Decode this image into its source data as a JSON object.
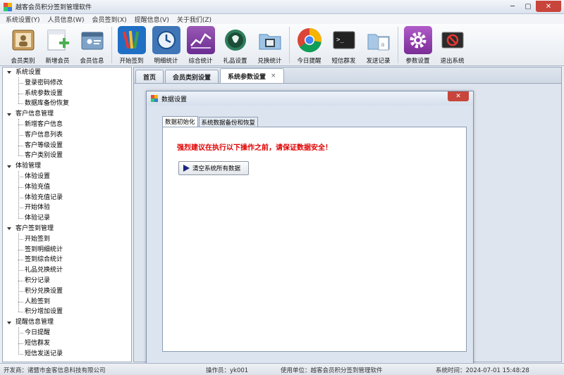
{
  "window": {
    "title": "越客会员积分签到管理软件"
  },
  "menu": [
    "系统设置(Y)",
    "人员信息(W)",
    "会员签到(X)",
    "提醒信息(V)",
    "关于我们(Z)"
  ],
  "toolbar": [
    {
      "label": "会员类别",
      "icon": "member-category-icon"
    },
    {
      "label": "新增会员",
      "icon": "add-member-icon"
    },
    {
      "label": "会员信息",
      "icon": "member-info-icon"
    },
    {
      "label": "开始签到",
      "icon": "start-signin-icon"
    },
    {
      "label": "明细统计",
      "icon": "detail-stats-icon"
    },
    {
      "label": "综合统计",
      "icon": "overall-stats-icon"
    },
    {
      "label": "礼品设置",
      "icon": "gift-settings-icon"
    },
    {
      "label": "兑换统计",
      "icon": "exchange-stats-icon"
    },
    {
      "label": "今日提醒",
      "icon": "today-reminder-icon"
    },
    {
      "label": "短信群发",
      "icon": "sms-broadcast-icon"
    },
    {
      "label": "发送记录",
      "icon": "send-record-icon"
    },
    {
      "label": "参数设置",
      "icon": "parameter-settings-icon"
    },
    {
      "label": "退出系统",
      "icon": "exit-system-icon"
    }
  ],
  "sidebar": [
    {
      "label": "系统设置",
      "children": [
        "登录密码修改",
        "系统参数设置",
        "数据库备份恢复"
      ]
    },
    {
      "label": "客户信息管理",
      "children": [
        "新增客户信息",
        "客户信息列表",
        "客户等级设置",
        "客户类别设置"
      ]
    },
    {
      "label": "体验管理",
      "children": [
        "体验设置",
        "体验充值",
        "体验充值记录",
        "开始体验",
        "体验记录"
      ]
    },
    {
      "label": "客户签到管理",
      "children": [
        "开始签到",
        "签到明细统计",
        "签到综合统计",
        "礼品兑换统计",
        "积分记录",
        "积分兑换设置",
        "人脸签到",
        "积分增加设置"
      ]
    },
    {
      "label": "提醒信息管理",
      "children": [
        "今日提醒",
        "短信群发",
        "短信发送记录"
      ]
    }
  ],
  "tabs": [
    {
      "label": "首页"
    },
    {
      "label": "会员类别设置"
    },
    {
      "label": "系统参数设置",
      "close": "×"
    }
  ],
  "dialog": {
    "title": "数据设置",
    "close": "✕",
    "tabs": [
      "数据初始化",
      "系统数据备份和恢复"
    ],
    "warning": "强烈建议在执行以下操作之前，请保证数据安全！",
    "button": "清空系统所有数据"
  },
  "status": {
    "developer": "开发商：诸暨市金客信息科技有限公司",
    "operator": "操作员：yk001",
    "unit": "使用单位：越客会员积分签到管理软件",
    "time": "系统时间：2024-07-01 15:48:28"
  },
  "colors": {
    "warning": "#e00000",
    "close": "#c8453b"
  }
}
